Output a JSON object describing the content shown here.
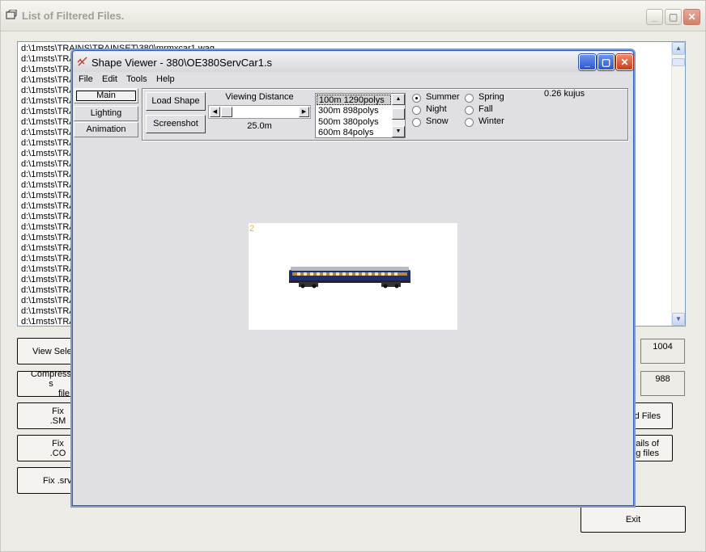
{
  "outer_window": {
    "title": "List of Filtered Files.",
    "file_rows": [
      "d:\\1msts\\TRAINS\\TRAINSET\\380\\mrmxcar1.wag",
      "d:\\1msts\\TRA",
      "d:\\1msts\\TRA",
      "d:\\1msts\\TRA",
      "d:\\1msts\\TRA",
      "d:\\1msts\\TRA",
      "d:\\1msts\\TRA",
      "d:\\1msts\\TRA",
      "d:\\1msts\\TRA",
      "d:\\1msts\\TRA",
      "d:\\1msts\\TRA",
      "d:\\1msts\\TRA",
      "d:\\1msts\\TRA",
      "d:\\1msts\\TRA",
      "d:\\1msts\\TRA",
      "d:\\1msts\\TRA",
      "d:\\1msts\\TRA",
      "d:\\1msts\\TRA",
      "d:\\1msts\\TRA",
      "d:\\1msts\\TRA",
      "d:\\1msts\\TRA",
      "d:\\1msts\\TRA",
      "d:\\1msts\\TRA",
      "d:\\1msts\\TRA",
      "d:\\1msts\\TRA",
      "d:\\1msts\\TRA",
      "d:\\1msts\\TRA"
    ],
    "buttons": {
      "view_selected": "View Sele",
      "compress_line1": "Compress s",
      "compress_line2": "file",
      "fix_sm": "Fix .SM",
      "fix_co": "Fix .CO",
      "fix_srv": "Fix .srv",
      "files": "d Files",
      "details_line1": "ails of",
      "details_line2": "g files",
      "exit": "Exit"
    },
    "counts": {
      "count1": "1004",
      "count2": "988"
    }
  },
  "viewer": {
    "title": "Shape Viewer - 380\\OE380ServCar1.s",
    "menu": [
      "File",
      "Edit",
      "Tools",
      "Help"
    ],
    "tabs": {
      "main": "Main",
      "lighting": "Lighting",
      "animation": "Animation"
    },
    "load_shape": "Load Shape",
    "screenshot": "Screenshot",
    "viewing_distance_label": "Viewing Distance",
    "viewing_distance_value": "25.0m",
    "lod_items": [
      "100m 1290polys",
      "300m 898polys",
      "500m 380polys",
      "600m 84polys"
    ],
    "seasons": {
      "summer": "Summer",
      "spring": "Spring",
      "night": "Night",
      "fall": "Fall",
      "snow": "Snow",
      "winter": "Winter"
    },
    "selected_season": "Summer",
    "fps": "0.26 kujus",
    "preview_label": "2"
  },
  "colors": {
    "arrow_red": "#e8140c",
    "arrow_orange": "#ffb020",
    "viewer_border": "#325cc0"
  }
}
